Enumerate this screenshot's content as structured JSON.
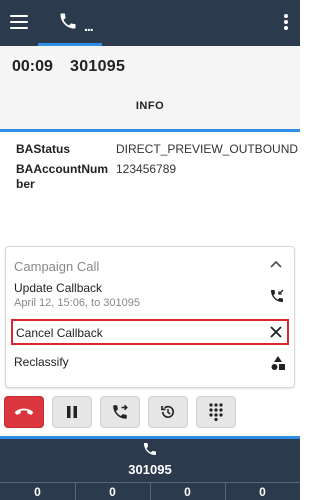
{
  "topbar": {
    "menu_icon": "hamburger-icon",
    "phone_tab_dots": "...",
    "more_icon": "more-vertical-icon"
  },
  "call": {
    "timer": "00:09",
    "number": "301095",
    "tab_info": "INFO"
  },
  "info": {
    "rows": [
      {
        "key": "BAStatus",
        "value": "DIRECT_PREVIEW_OUTBOUND"
      },
      {
        "key": "BAAccountNumber",
        "value": "123456789"
      }
    ]
  },
  "campaign": {
    "title": "Campaign Call",
    "actions": {
      "update_callback": {
        "label": "Update Callback",
        "detail": "April 12, 15:06, to 301095"
      },
      "cancel_callback": {
        "label": "Cancel Callback"
      },
      "reclassify": {
        "label": "Reclassify"
      }
    }
  },
  "controls": {
    "hangup_icon": "hangup-icon",
    "hold_icon": "pause-icon",
    "transfer_icon": "transfer-call-icon",
    "history_icon": "history-icon",
    "dialpad_icon": "dialpad-icon"
  },
  "bottom": {
    "number": "301095",
    "counters": [
      "0",
      "0",
      "0",
      "0"
    ]
  },
  "colors": {
    "topbar": "#2c3a4e",
    "accent": "#2f8de4",
    "hangup": "#d9363e",
    "highlight": "#d9282f"
  }
}
